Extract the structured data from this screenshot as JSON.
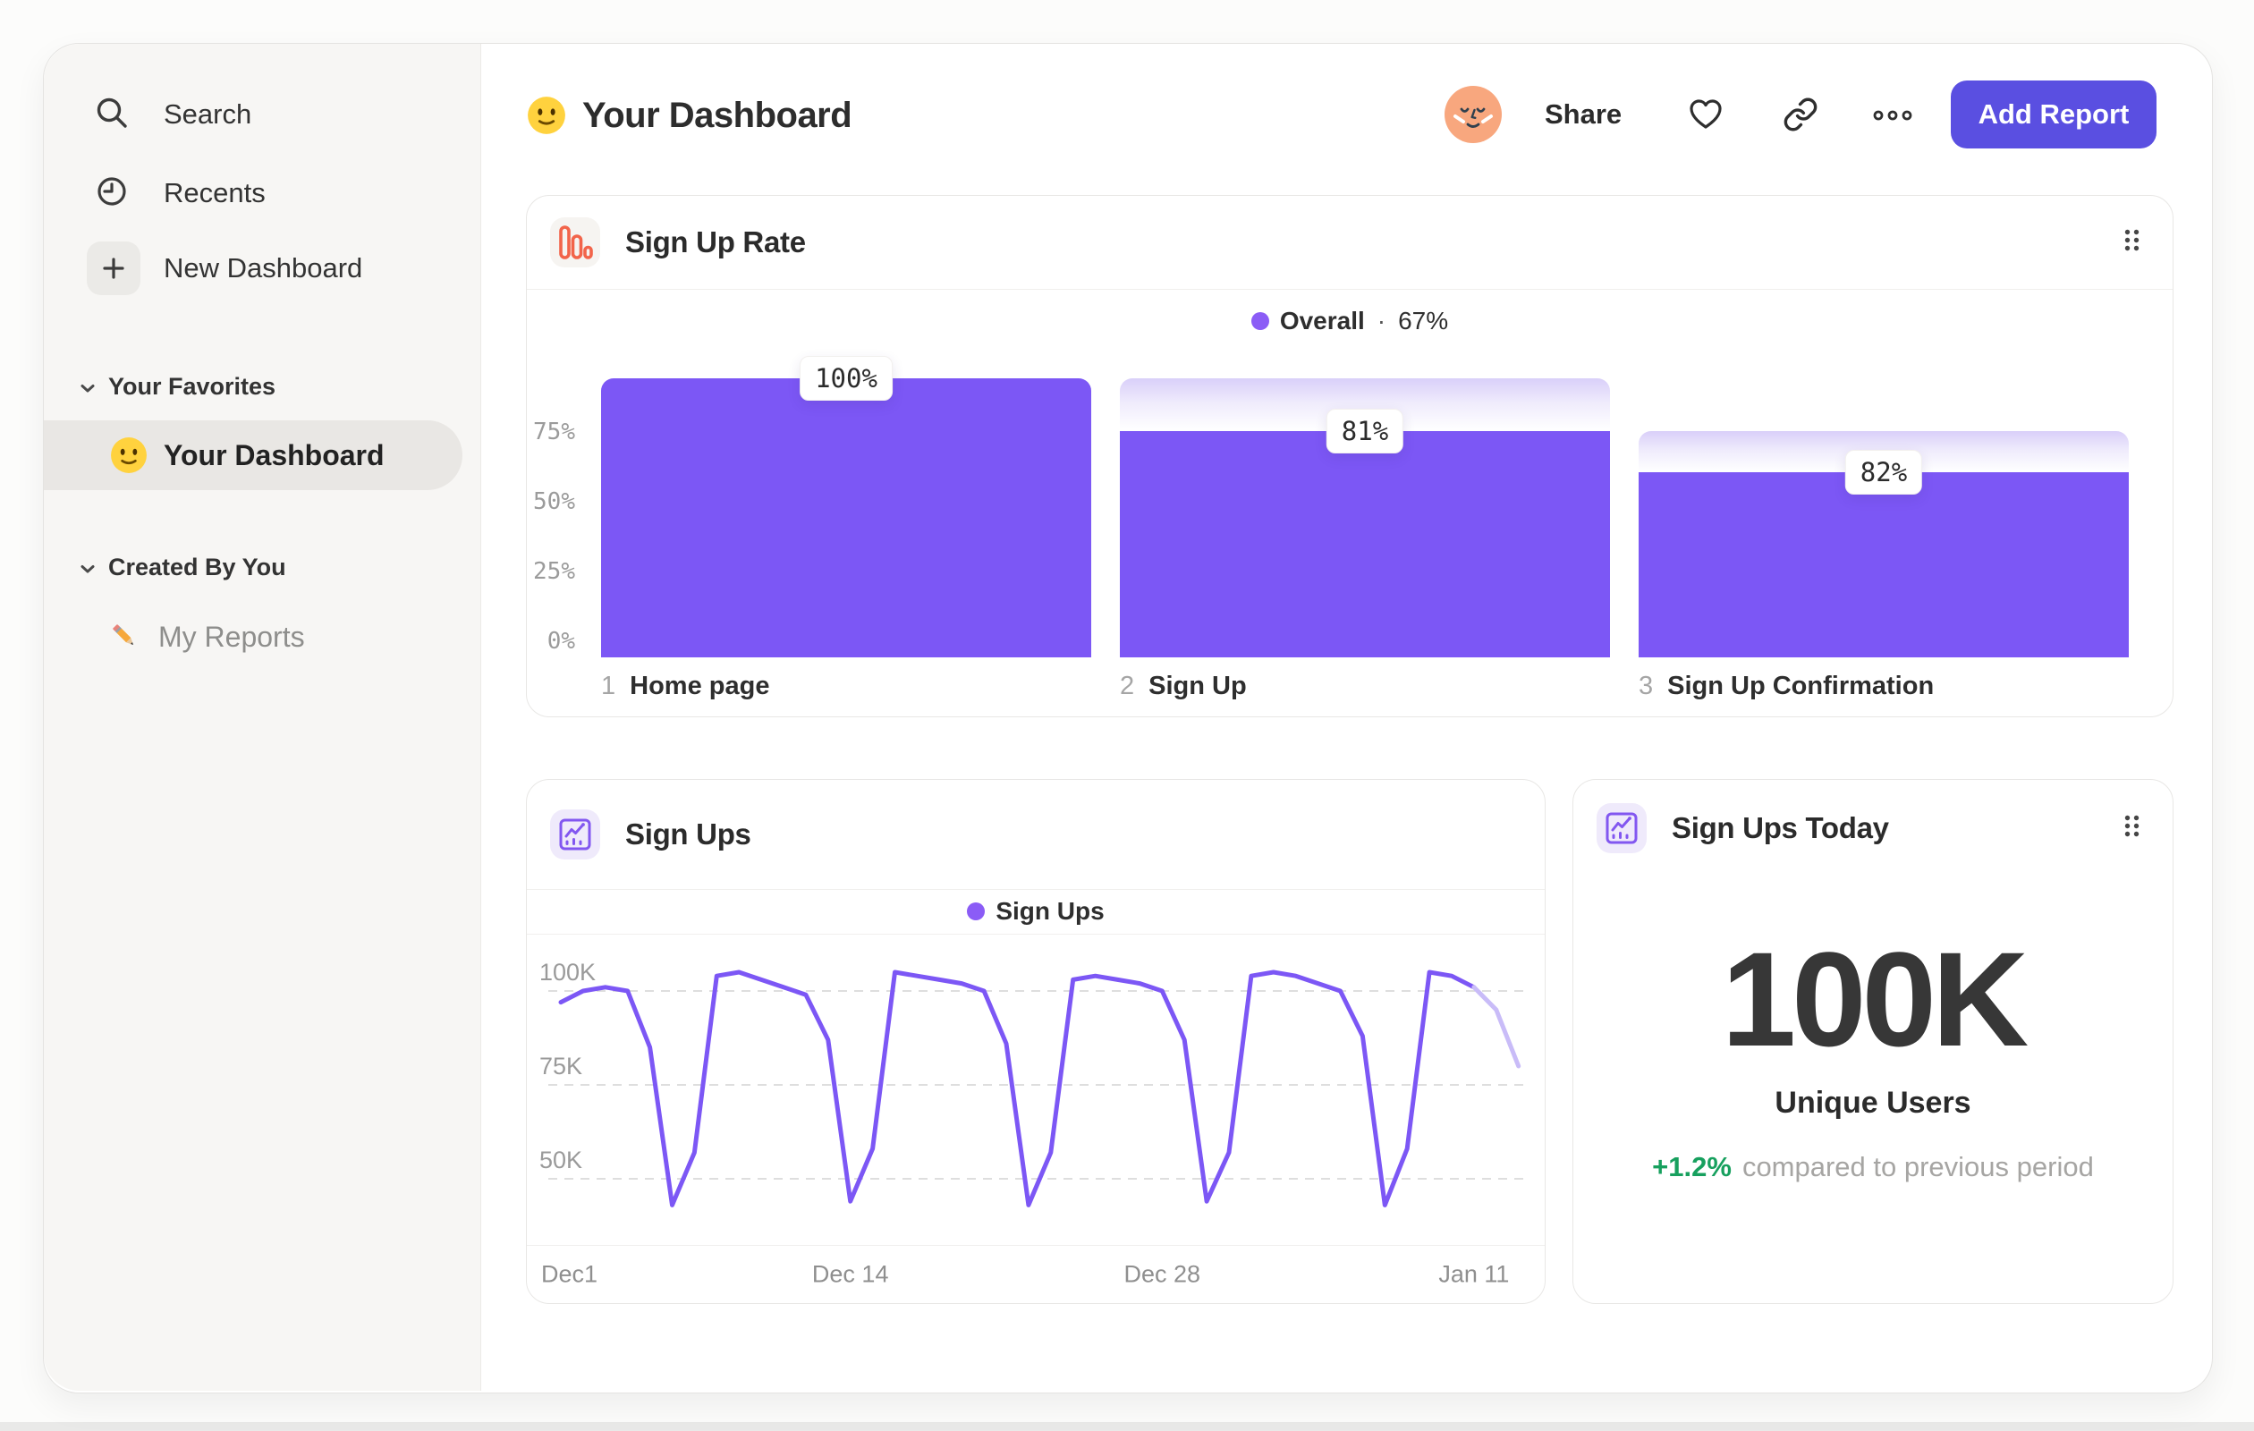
{
  "sidebar": {
    "top_items": [
      {
        "label": "Search",
        "icon": "search-icon"
      },
      {
        "label": "Recents",
        "icon": "recents-icon"
      },
      {
        "label": "New Dashboard",
        "icon": "plus-icon"
      }
    ],
    "sections": [
      {
        "label": "Your Favorites",
        "icon": "chevron-down-icon",
        "items": [
          {
            "label": "Your Dashboard",
            "icon": "smiley-emoji",
            "active": true
          }
        ]
      },
      {
        "label": "Created By You",
        "icon": "chevron-down-icon",
        "items": [
          {
            "label": "My Reports",
            "icon": "pencil-emoji",
            "active": false
          }
        ]
      }
    ]
  },
  "header": {
    "title_icon": "smiley-emoji",
    "title": "Your Dashboard",
    "avatar": "avatar",
    "share_label": "Share",
    "icons": [
      "heart-icon",
      "link-icon",
      "more-icon"
    ],
    "add_report_label": "Add Report"
  },
  "colors": {
    "accent_purple": "#7C57F5",
    "accent_purple_cap_top": "#D9CFF9",
    "legend_dot": "#8B5CF6",
    "button_indigo": "#5A4FE1",
    "positive_green": "#17A05E",
    "icon_orange": "#F2644A",
    "icon_purple": "#8257F0",
    "line_faded": "#C9BCF8"
  },
  "chart_data": [
    {
      "type": "bar",
      "subtype": "funnel",
      "title": "Sign Up Rate",
      "legend": {
        "label": "Overall",
        "separator": "·",
        "value": "67%"
      },
      "step_numbers": [
        "1",
        "2",
        "3"
      ],
      "categories": [
        "Home page",
        "Sign Up",
        "Sign Up Confirmation"
      ],
      "values": [
        100,
        81,
        82
      ],
      "badge_labels": [
        "100%",
        "81%",
        "82%"
      ],
      "cumulative": [
        1.0,
        0.81,
        0.664
      ],
      "cap": [
        1.0,
        1.0,
        0.81
      ],
      "y_ticks": [
        {
          "label": "75%",
          "frac": 0.75
        },
        {
          "label": "50%",
          "frac": 0.5
        },
        {
          "label": "25%",
          "frac": 0.25
        },
        {
          "label": "0%",
          "frac": 0.0
        }
      ],
      "ylim": [
        0,
        100
      ],
      "legend_position": "top-center",
      "grid": false
    },
    {
      "type": "line",
      "title": "Sign Ups",
      "legend": "Sign Ups",
      "unit": "K",
      "values_k": [
        97,
        100,
        101,
        100,
        85,
        43,
        57,
        104,
        105,
        103,
        101,
        99,
        87,
        44,
        58,
        105,
        104,
        103,
        102,
        100,
        86,
        43,
        57,
        103,
        104,
        103,
        102,
        100,
        87,
        44,
        57,
        104,
        105,
        104,
        102,
        100,
        88,
        43,
        58,
        105,
        104,
        101,
        95,
        80
      ],
      "faded_from_index": 41,
      "x_ticks": [
        {
          "label": "Dec1",
          "day": 0
        },
        {
          "label": "Dec 14",
          "day": 13
        },
        {
          "label": "Dec 28",
          "day": 27
        },
        {
          "label": "Jan 11",
          "day": 41
        }
      ],
      "y_ticks": [
        {
          "label": "100K",
          "value": 100
        },
        {
          "label": "75K",
          "value": 75
        },
        {
          "label": "50K",
          "value": 50
        }
      ],
      "ylim": [
        38,
        110
      ],
      "grid": "dashed-horizontal",
      "legend_position": "top-center"
    },
    {
      "type": "metric",
      "title": "Sign Ups Today",
      "value": "100K",
      "label": "Unique Users",
      "delta": "+1.2%",
      "delta_note": "compared to previous period"
    }
  ]
}
